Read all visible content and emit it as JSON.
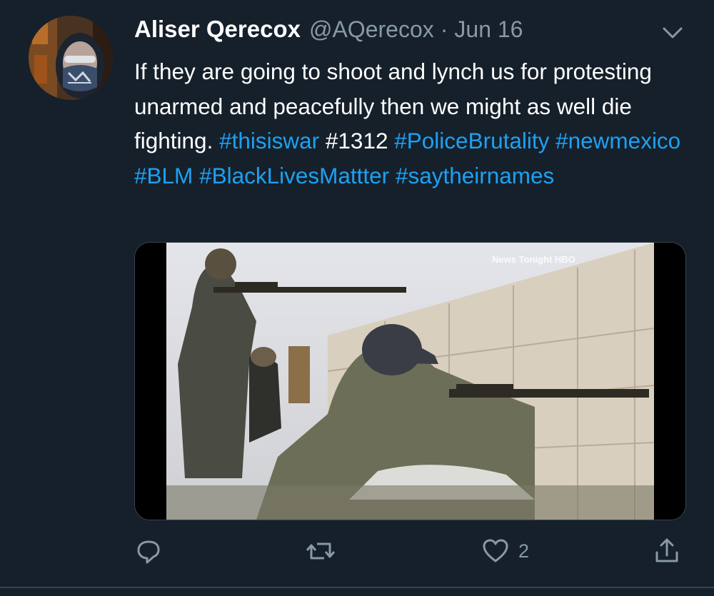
{
  "tweet": {
    "display_name": "Aliser Qerecox",
    "handle": "@AQerecox",
    "separator": "·",
    "date": "Jun 16",
    "text_segments": [
      {
        "text": "If they are going to shoot and lynch us for protesting unarmed and peacefully then we might as well die fighting. ",
        "type": "text"
      },
      {
        "text": "#thisiswar",
        "type": "hashtag"
      },
      {
        "text": " #1312 ",
        "type": "text"
      },
      {
        "text": "#PoliceBrutality",
        "type": "hashtag"
      },
      {
        "text": " ",
        "type": "text"
      },
      {
        "text": "#newmexico",
        "type": "hashtag"
      },
      {
        "text": " ",
        "type": "text"
      },
      {
        "text": "#BLM",
        "type": "hashtag"
      },
      {
        "text": " ",
        "type": "text"
      },
      {
        "text": "#BlackLivesMattter",
        "type": "hashtag"
      },
      {
        "text": " ",
        "type": "text"
      },
      {
        "text": "#saytheirnames",
        "type": "hashtag"
      }
    ],
    "media": {
      "watermark": "News Tonight  HBO"
    }
  },
  "actions": {
    "reply_icon": "reply-icon",
    "retweet_icon": "retweet-icon",
    "like_icon": "heart-icon",
    "like_count": "2",
    "share_icon": "share-icon"
  },
  "colors": {
    "background": "#15202b",
    "text": "#ffffff",
    "secondary": "#8899a6",
    "link": "#1da1f2",
    "border": "#38444d"
  }
}
